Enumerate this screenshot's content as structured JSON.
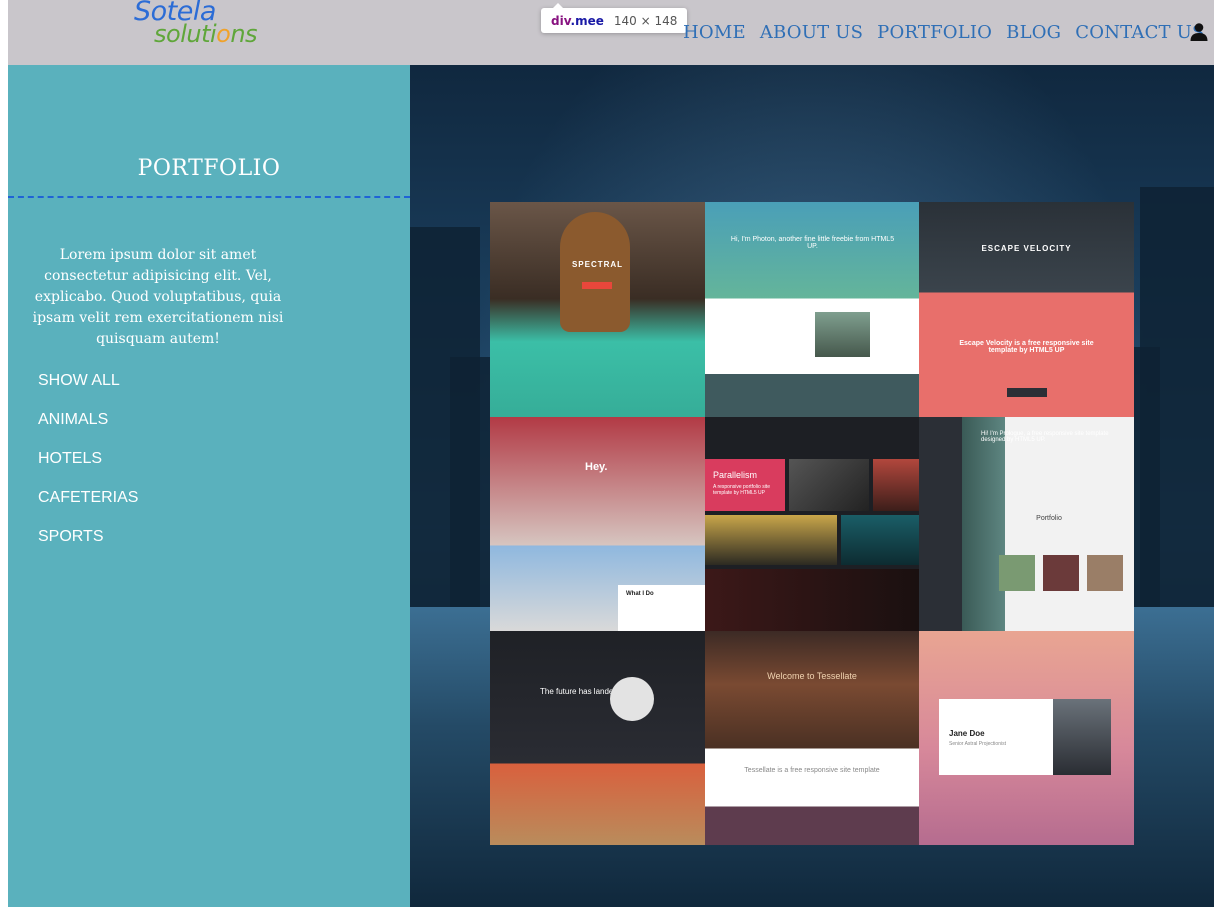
{
  "header": {
    "logo": {
      "top": "Sotela",
      "bottom_prefix": "soluti",
      "bottom_gear": "o",
      "bottom_suffix": "ns"
    },
    "devtools_tooltip": {
      "tag": "div",
      "cls": ".mee",
      "size": "140 × 148"
    },
    "nav": [
      {
        "label": "HOME"
      },
      {
        "label": "ABOUT US"
      },
      {
        "label": "PORTFOLIO"
      },
      {
        "label": "BLOG"
      },
      {
        "label": "CONTACT US"
      }
    ],
    "user_icon": "user-icon"
  },
  "sidebar": {
    "title": "PORTFOLIO",
    "description": "Lorem ipsum dolor sit amet consectetur adipisicing elit. Vel, explicabo. Quod voluptatibus, quia ipsam velit rem exercitationem nisi quisquam autem!",
    "filters": [
      {
        "label": "SHOW ALL"
      },
      {
        "label": "ANIMALS"
      },
      {
        "label": "HOTELS"
      },
      {
        "label": "CAFETERIAS"
      },
      {
        "label": "SPORTS"
      }
    ]
  },
  "portfolio_tiles": [
    {
      "name": "spectral",
      "label": "SPECTRAL"
    },
    {
      "name": "photon",
      "label": "Hi, I'm Photon, another fine little freebie from HTML5 UP."
    },
    {
      "name": "escape-velocity",
      "label": "ESCAPE VELOCITY",
      "sub": "Escape Velocity is a free responsive site template by HTML5 UP"
    },
    {
      "name": "hey",
      "label": "Hey.",
      "sub": "What I Do"
    },
    {
      "name": "parallelism",
      "label": "Parallelism",
      "sub": "A responsive portfolio site template by HTML5 UP"
    },
    {
      "name": "prologue",
      "label": "Hi! I'm Prologue, a free responsive site template designed by HTML5 UP.",
      "sub": "Portfolio"
    },
    {
      "name": "the-future",
      "label": "The future has landed"
    },
    {
      "name": "tessellate",
      "label": "Welcome to Tessellate",
      "sub": "Tessellate is a free responsive site template"
    },
    {
      "name": "jane-doe",
      "label": "Jane Doe",
      "sub": "Senior Astral Projectionist"
    }
  ],
  "colors": {
    "sidebar": "#5ab1bd",
    "header": "#c9c6cb",
    "nav": "#2f6fb6",
    "rule": "#1f63d6"
  }
}
